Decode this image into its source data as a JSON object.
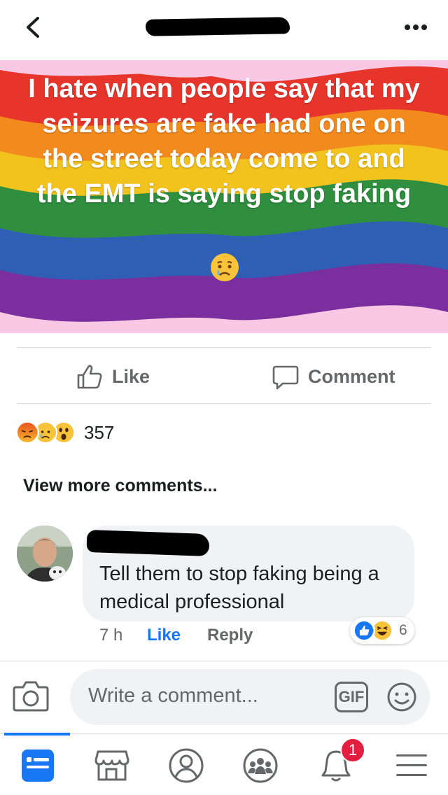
{
  "post": {
    "text": "I hate when people say that my seizures are fake had one on the street today come to and the EMT is saying stop faking",
    "emoji": "crying-face"
  },
  "actions": {
    "like_label": "Like",
    "comment_label": "Comment"
  },
  "reactions": {
    "types": [
      "angry",
      "sad",
      "wow"
    ],
    "count": "357"
  },
  "comments": {
    "view_more": "View more comments...",
    "items": [
      {
        "text": "Tell them to stop faking being a medical professional",
        "time": "7 h",
        "like_label": "Like",
        "reply_label": "Reply",
        "reaction_types": [
          "like",
          "haha"
        ],
        "reaction_count": "6"
      }
    ]
  },
  "composer": {
    "placeholder": "Write a comment...",
    "gif_label": "GIF"
  },
  "nav": {
    "items": [
      "feed-icon",
      "marketplace-icon",
      "profile-icon",
      "groups-icon",
      "notifications-icon",
      "menu-icon"
    ],
    "notification_badge": "1"
  },
  "colors": {
    "accent": "#1877f2",
    "badge": "#e41e3f"
  }
}
